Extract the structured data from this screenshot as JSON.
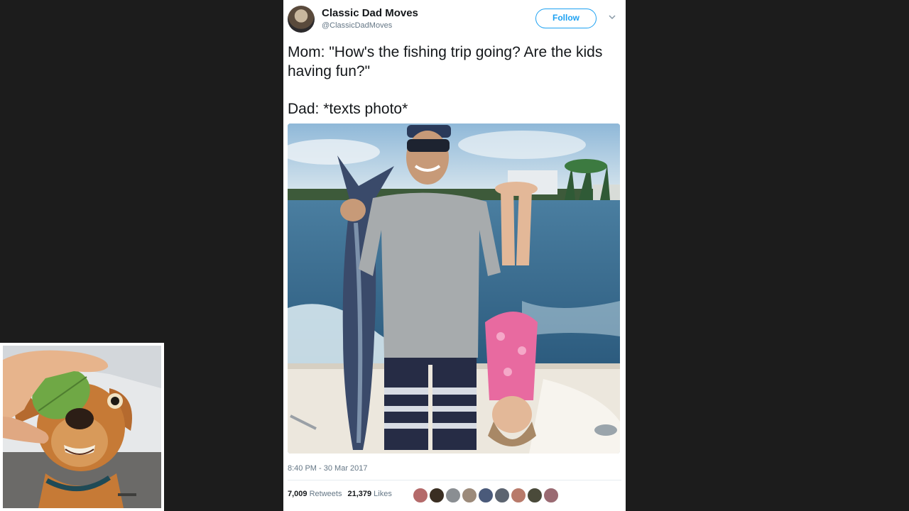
{
  "tweet": {
    "author": {
      "display_name": "Classic Dad Moves",
      "handle": "@ClassicDadMoves"
    },
    "follow_label": "Follow",
    "text_lines": [
      "Mom: \"How's the fishing trip going? Are the kids having fun?\"",
      "Dad: *texts photo*"
    ],
    "timestamp": "8:40 PM - 30 Mar 2017",
    "stats": {
      "retweets_count": "7,009",
      "retweets_label": "Retweets",
      "likes_count": "21,379",
      "likes_label": "Likes"
    },
    "liker_avatar_count": 9
  },
  "colors": {
    "background": "#1c1c1c",
    "twitter_blue": "#1da1f2",
    "text_primary": "#14171a",
    "text_secondary": "#657786"
  },
  "icons": [
    "chevron-down-icon"
  ]
}
